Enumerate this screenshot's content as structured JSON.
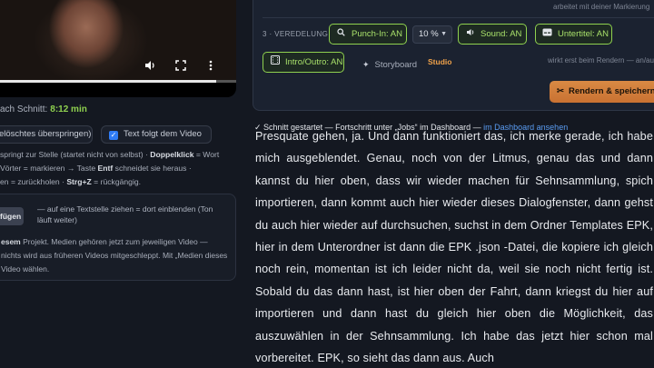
{
  "video": {
    "progress_fraction": 0.92
  },
  "cut": {
    "label": "ach Schnitt:",
    "duration": "8:12 min"
  },
  "options": {
    "skip_deleted_label": "elöschtes überspringen)",
    "follow_video_label": "Text folgt dem Video"
  },
  "help": {
    "part1": "springt zur Stelle (startet nicht von selbst) · ",
    "doubleclick": "Doppelklick",
    "part2": " = Wort",
    "part3": "Vörter = markieren → Taste ",
    "entf": "Entf",
    "part4": " schneidet sie heraus ·",
    "part5": "en = zurückholen · ",
    "undo": "Strg+Z",
    "part6": " = rückgängig."
  },
  "insert": {
    "button_label": "fügen",
    "hint": "— auf eine Textstelle ziehen = dort einblenden (Ton läuft weiter)",
    "project_bold": "esem",
    "project_rest": " Projekt. Medien gehören jetzt zum jeweiligen Video — nichts wird aus früheren Videos mitgeschleppt. Mit „Medien dieses Video wählen."
  },
  "panel": {
    "top_note": "arbeitet mit deiner Markierung",
    "step_label": "3 · VEREDELUNG",
    "punch_in": "Punch-In: AN",
    "zoom_value": "10 %",
    "sound": "Sound: AN",
    "subtitle": "Untertitel: AN",
    "intro_outro": "Intro/Outro: AN",
    "storyboard": "Storyboard",
    "studio": "Studio",
    "render_note": "wirkt erst beim Rendern — an/aus",
    "render_button": "Rendern & speichern"
  },
  "status": {
    "text": "✓ Schnitt gestartet — Fortschritt unter „Jobs“ im Dashboard — ",
    "link": "im Dashboard ansehen"
  },
  "transcript": {
    "text": "Presquate gehen, ja. Und dann funktioniert das, ich merke gerade, ich habe mich ausgeblendet. Genau, noch von der Litmus, genau das und dann kannst du hier oben, dass wir wieder machen für Sehnsammlung, spich importieren, dann kommt auch hier wieder dieses Dialogfenster, dann gehst du auch hier wieder auf durchsuchen, suchst in dem Ordner Templates EPK, hier in dem Unterordner ist dann die EPK .json -Datei, die kopiere ich gleich noch rein, momentan ist ich leider nicht da, weil sie noch nicht fertig ist. Sobald du das dann hast, ist hier oben der Fahrt, dann kriegst du hier auf importieren und dann hast du gleich hier oben die Möglichkeit, das auszuwählen in der Sehnsammlung. Ich habe das jetzt hier schon mal vorbereitet. EPK, so sieht das dann aus. Auch"
  },
  "colors": {
    "background": "#141821",
    "accent_green": "#8fd14f",
    "accent_orange": "#e8873a",
    "link_blue": "#5a9cf2",
    "checkbox_blue": "#2f7cf6"
  }
}
